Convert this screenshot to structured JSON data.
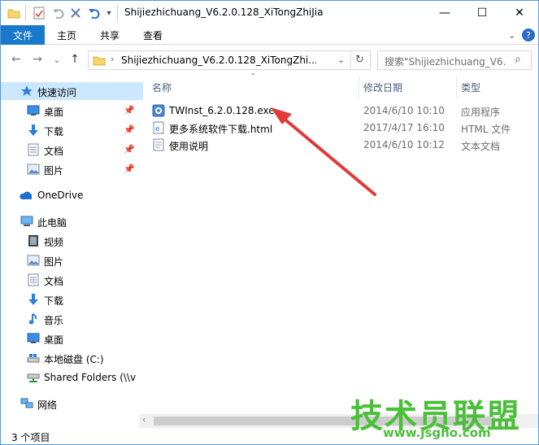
{
  "window": {
    "title": "Shijiezhichuang_V6.2.0.128_XiTongZhiJia",
    "minimize": "—",
    "maximize": "☐",
    "close": "✕"
  },
  "ribbon": {
    "tabs": [
      "文件",
      "主页",
      "共享",
      "查看"
    ]
  },
  "navbar": {
    "back": "←",
    "forward": "→",
    "recent": "⌄",
    "up": "↑",
    "path": "Shijiezhichuang_V6.2.0.128_XiTongZhi...",
    "dropdown": "⌄",
    "refresh": "↻",
    "search_placeholder": "搜索\"Shijiezhichuang_V6....",
    "search_icon": "⌕"
  },
  "sidebar": {
    "items": [
      {
        "label": "快速访问",
        "icon": "star-icon"
      },
      {
        "label": "桌面",
        "icon": "desktop-icon",
        "pinned": true
      },
      {
        "label": "下载",
        "icon": "download-icon",
        "pinned": true
      },
      {
        "label": "文档",
        "icon": "document-icon",
        "pinned": true
      },
      {
        "label": "图片",
        "icon": "picture-icon",
        "pinned": true
      },
      {
        "label": "OneDrive",
        "icon": "cloud-icon"
      },
      {
        "label": "此电脑",
        "icon": "computer-icon"
      },
      {
        "label": "视频",
        "icon": "video-icon"
      },
      {
        "label": "图片",
        "icon": "picture-icon"
      },
      {
        "label": "文档",
        "icon": "document-icon"
      },
      {
        "label": "下载",
        "icon": "download-icon"
      },
      {
        "label": "音乐",
        "icon": "music-icon"
      },
      {
        "label": "桌面",
        "icon": "desktop-icon"
      },
      {
        "label": "本地磁盘 (C:)",
        "icon": "drive-icon"
      },
      {
        "label": "Shared Folders (\\\\v",
        "icon": "network-drive-icon"
      },
      {
        "label": "网络",
        "icon": "network-icon"
      }
    ]
  },
  "columns": {
    "name": "名称",
    "date": "修改日期",
    "type": "类型"
  },
  "files": [
    {
      "name": "TWInst_6.2.0.128.exe",
      "date": "2014/6/10 10:10",
      "type": "应用程序",
      "icon": "exe-icon"
    },
    {
      "name": "更多系统软件下载.html",
      "date": "2017/4/17 16:10",
      "type": "HTML 文件",
      "icon": "html-icon"
    },
    {
      "name": "使用说明",
      "date": "2014/6/10 10:12",
      "type": "文本文档",
      "icon": "text-icon"
    }
  ],
  "status": {
    "count": "3 个项目"
  },
  "watermark": {
    "text": "技术员联盟",
    "url": "www.jsgho.com"
  },
  "colors": {
    "accent": "#1979ca",
    "selection": "#cce8ff",
    "arrow": "#e03a3a",
    "watermark": "#4bbf3a"
  }
}
